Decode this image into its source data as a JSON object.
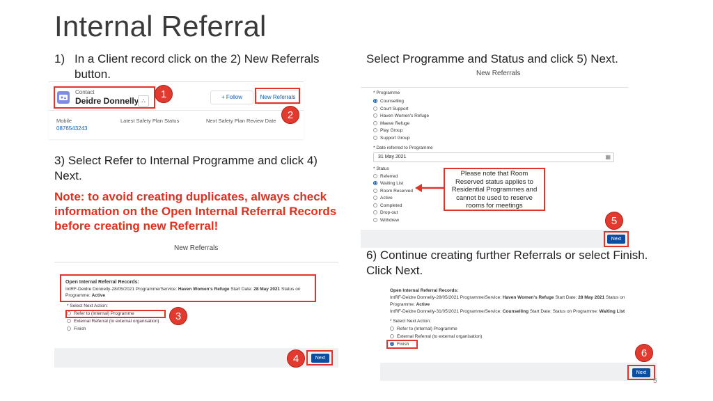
{
  "title": "Internal Referral",
  "steps": {
    "s1_num": "1)",
    "s1_line1": "In a Client record click on the 2) New Referrals",
    "s1_line2": "button.",
    "s3_line1": "3) Select Refer to Internal Programme and click 4)",
    "s3_line2": "Next.",
    "note_line1": "Note: to avoid creating duplicates, always check",
    "note_line2": "information on the Open Internal Referral Records",
    "note_line3": "before creating new Referral!",
    "s5": "Select Programme and Status and click 5) Next.",
    "s6_line1": "6) Continue creating further Referrals or select Finish.",
    "s6_line2": "Click Next."
  },
  "contact_panel": {
    "type_label": "Contact",
    "name": "Deidre Donnelly",
    "follow_label": "+ Follow",
    "new_referrals_label": "New Referrals",
    "col_mobile": "Mobile",
    "mobile_value": "0876543243",
    "col_safety": "Latest Safety Plan Status",
    "col_review": "Next Safety Plan Review Date"
  },
  "badges": [
    "1",
    "2",
    "3",
    "4",
    "5",
    "6"
  ],
  "modal3": {
    "header": "New Referrals",
    "records_title": "Open Internal Referral Records:",
    "record_line_a": "IntRF-Deidre Donnelly-28/05/2021 Programme/Service: ",
    "record_service": "Haven Women's Refuge",
    "record_line_b": " Start Date: ",
    "record_date": "28 May 2021",
    "record_line_c": " Status on",
    "record_line_d": "Programme: ",
    "record_status": "Active",
    "next_action_label": "* Select Next Action:",
    "opt1": "Refer to (Internal) Programme",
    "opt2": "External Referral (to external organisation)",
    "opt3": "Finish",
    "next_label": "Next"
  },
  "modal5": {
    "header": "New Referrals",
    "programme_label": "* Programme",
    "programmes": [
      "Counselling",
      "Court Support",
      "Haven Women's Refuge",
      "Maeve Refuge",
      "Play Group",
      "Support Group"
    ],
    "date_label": "* Date referred to Programme",
    "date_value": "31 May 2021",
    "status_label": "* Status",
    "statuses": [
      "Referred",
      "Waiting List",
      "Room Reserved",
      "Active",
      "Completed",
      "Drop-out",
      "Withdrew"
    ],
    "callout_line1": "Please note that Room",
    "callout_line2": "Reserved status applies to",
    "callout_line3": "Residential Programmes and",
    "callout_line4": "cannot be used to reserve",
    "callout_line5": "rooms for meetings",
    "next_label": "Next"
  },
  "modal6": {
    "records_title": "Open Internal Referral Records:",
    "r1_a": "IntRF-Deidre Donnelly-28/05/2021 Programme/Service: ",
    "r1_service": "Haven Women's Refuge",
    "r1_b": " Start Date: ",
    "r1_date": "28 May 2021",
    "r1_c": " Status on",
    "r1_d": "Programme: ",
    "r1_status": "Active",
    "r2_a": "IntRF-Deidre Donnelly-31/05/2021 Programme/Service: ",
    "r2_service": "Counselling",
    "r2_b": " Start Date: Status on Programme: ",
    "r2_status": "Waiting List",
    "next_action_label": "* Select Next Action:",
    "opt1": "Refer to (Internal) Programme",
    "opt2": "External Referral (to external organisation)",
    "opt3": "Finish",
    "next_label": "Next"
  },
  "page_number": "5"
}
